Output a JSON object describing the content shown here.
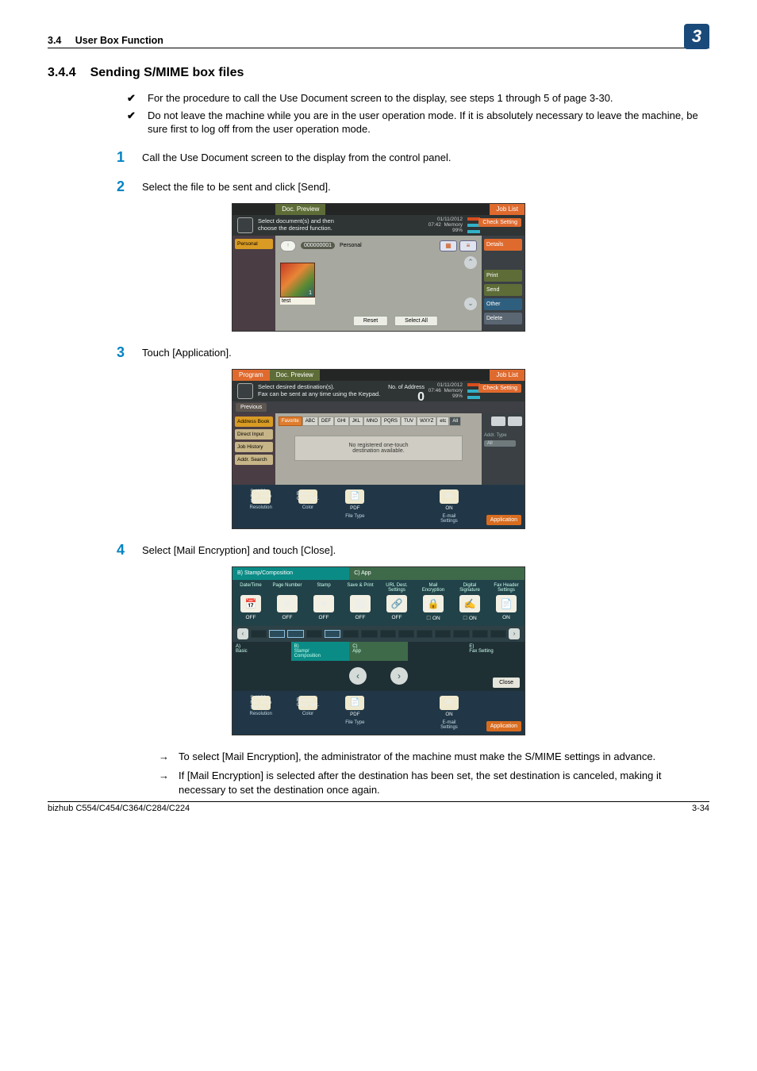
{
  "header": {
    "section_num": "3.4",
    "section_title": "User Box Function",
    "chapter_badge": "3"
  },
  "heading": {
    "number": "3.4.4",
    "title": "Sending S/MIME box files"
  },
  "intro_bullets": [
    "For the procedure to call the Use Document screen to the display, see steps 1 through 5 of page 3-30.",
    "Do not leave the machine while you are in the user operation mode. If it is absolutely necessary to leave the machine, be sure first to log off from the user operation mode."
  ],
  "steps": {
    "s1": "Call the Use Document screen to the display from the control panel.",
    "s2": "Select the file to be sent and click [Send].",
    "s3": "Touch [Application].",
    "s4": "Select [Mail Encryption] and touch [Close]."
  },
  "notes": [
    "To select [Mail Encryption], the administrator of the machine must make the S/MIME settings in advance.",
    "If [Mail Encryption] is selected after the destination has been set, the set destination is canceled, making it necessary to set the destination once again."
  ],
  "shot1": {
    "tab_doc_preview": "Doc. Preview",
    "tab_job_list": "Job List",
    "strip_line1": "Select document(s) and then",
    "strip_line2": "choose the desired function.",
    "date_line1": "01/11/2012",
    "date_line2": "07:42",
    "date_line3": "Memory",
    "date_line4": "99%",
    "check_setting": "Check Setting",
    "side_tab": "Personal",
    "breadcrumb_box": "000000001",
    "breadcrumb_name": "Personal",
    "file_name": "test",
    "btn_details": "Details",
    "btn_print": "Print",
    "btn_send": "Send",
    "btn_other": "Other",
    "btn_delete": "Delete",
    "btn_reset": "Reset",
    "btn_select_all": "Select All"
  },
  "shot2": {
    "tab_program": "Program",
    "tab_doc_preview": "Doc. Preview",
    "tab_job_list": "Job List",
    "strip_line1": "Select desired destination(s).",
    "strip_line2": "Fax can be sent at any time using the Keypad.",
    "no_addr_label": "No. of Address",
    "no_addr_value": "0",
    "date_line1": "01/11/2012",
    "date_line2": "07:46",
    "date_line3": "Memory",
    "date_line4": "99%",
    "check_setting": "Check Setting",
    "previous": "Previous",
    "s_address_book": "Address Book",
    "s_direct_input": "Direct Input",
    "s_job_history": "Job History",
    "s_addr_search": "Addr. Search",
    "alpha": [
      "Favorite",
      "ABC",
      "DEF",
      "GHI",
      "JKL",
      "MNO",
      "PQRS",
      "TUV",
      "WXYZ",
      "etc",
      "All"
    ],
    "no_reg_l1": "No registered one-touch",
    "no_reg_l2": "destination available.",
    "rlbl_addr_type": "Addr. Type",
    "rlbl_addr_type_val": "All",
    "opt_cols": [
      {
        "val": "S. W28\nFax: Mem\nSaving",
        "lab": "Resolution"
      },
      {
        "val": "Existing\nColor Sett.",
        "lab": "Color"
      },
      {
        "val": "PDF",
        "lab": "File Type"
      },
      {
        "val": "",
        "lab": ""
      },
      {
        "val": "ON",
        "lab": "E-mail\nSettings"
      }
    ],
    "application": "Application"
  },
  "shot3": {
    "hdr_left": "B)   Stamp/Composition",
    "hdr_right": "C)   App",
    "cols": [
      {
        "hd": "Date/Time",
        "st": "OFF"
      },
      {
        "hd": "Page Number",
        "st": "OFF"
      },
      {
        "hd": "Stamp",
        "st": "OFF"
      },
      {
        "hd": "Save & Print",
        "st": "OFF"
      },
      {
        "hd": "URL Dest.\nSettings",
        "st": "OFF"
      },
      {
        "hd": "Mail\nEncryption",
        "st": "ON",
        "chk": true
      },
      {
        "hd": "Digital\nSignature",
        "st": "ON",
        "chk": true
      },
      {
        "hd": "Fax Header\nSettings",
        "st": "ON"
      }
    ],
    "cats": {
      "a": "A)\nBasic",
      "b": "B)\nStamp/\nComposition",
      "c": "C)\nApp",
      "d": "",
      "e": "E)\nFax Setting"
    },
    "close": "Close",
    "opt_cols": [
      {
        "val": "S. W28\nFax: Mem\nSaving",
        "lab": "Resolution"
      },
      {
        "val": "Existing\nColor Sett.",
        "lab": "Color"
      },
      {
        "val": "PDF",
        "lab": "File Type"
      },
      {
        "val": "",
        "lab": ""
      },
      {
        "val": "ON",
        "lab": "E-mail\nSettings"
      }
    ],
    "application": "Application"
  },
  "footer": {
    "left": "bizhub C554/C454/C364/C284/C224",
    "right": "3-34"
  }
}
